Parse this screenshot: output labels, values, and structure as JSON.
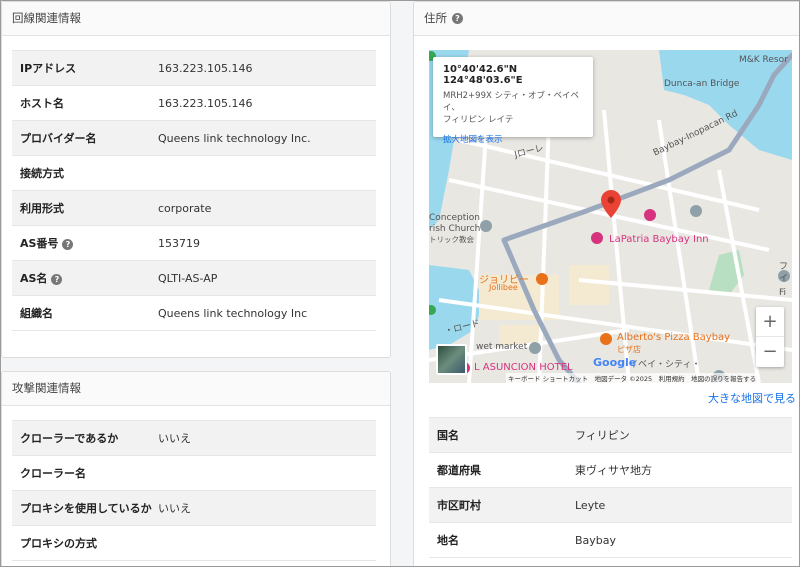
{
  "network": {
    "title": "回線関連情報",
    "rows": [
      {
        "key": "IPアドレス",
        "value": "163.223.105.146",
        "help": false
      },
      {
        "key": "ホスト名",
        "value": "163.223.105.146",
        "help": false
      },
      {
        "key": "プロバイダー名",
        "value": "Queens link technology Inc.",
        "help": false
      },
      {
        "key": "接続方式",
        "value": "",
        "help": false
      },
      {
        "key": "利用形式",
        "value": "corporate",
        "help": false
      },
      {
        "key": "AS番号",
        "value": "153719",
        "help": true
      },
      {
        "key": "AS名",
        "value": "QLTI-AS-AP",
        "help": true
      },
      {
        "key": "組織名",
        "value": "Queens link technology Inc",
        "help": false
      }
    ]
  },
  "attack": {
    "title": "攻撃関連情報",
    "rows": [
      {
        "key": "クローラーであるか",
        "value": "いいえ"
      },
      {
        "key": "クローラー名",
        "value": ""
      },
      {
        "key": "プロキシを使用しているか",
        "value": "いいえ"
      },
      {
        "key": "プロキシの方式",
        "value": ""
      }
    ]
  },
  "address": {
    "title": "住所",
    "map": {
      "coords": "10°40'42.6\"N 124°48'03.6\"E",
      "plus_code": "MRH2+99X シティ・オブ・ベイベイ、",
      "region": "フィリピン レイテ",
      "enlarge_link": "拡大地図を表示",
      "labels": {
        "mk": "M&K Resor",
        "dunca": "Dunca-an Bridge",
        "baybay_road": "Baybay-Inopacan Rd",
        "conception1": "Conception",
        "conception2": "rish Church",
        "conception3": "トリック教会",
        "lapatria": "LaPatria Baybay Inn",
        "jollibee1": "ジョリビー",
        "jollibee2": "Jollibee",
        "alberto1": "Alberto's Pizza Baybay",
        "alberto2": "ピザ店",
        "wet_market": "wet market",
        "asuncion": "L ASUNCION HOTEL",
        "city": "イベイ・シティ・",
        "road1": "Jローレ",
        "road2": "・ロード",
        "side1": "フ",
        "side2": "イ",
        "side3": "Fi"
      },
      "attribution": "キーボード ショートカット　地図データ ©2025　利用規約　地図の誤りを報告する",
      "google": "Google",
      "zoom_in": "+",
      "zoom_out": "−"
    },
    "view_larger": "大きな地図で見る",
    "rows": [
      {
        "key": "国名",
        "value": "フィリピン"
      },
      {
        "key": "都道府県",
        "value": "東ヴィサヤ地方"
      },
      {
        "key": "市区町村",
        "value": "Leyte"
      },
      {
        "key": "地名",
        "value": "Baybay"
      }
    ]
  },
  "colors": {
    "link": "#1a73e8",
    "pin": "#ea4335",
    "poi": "#d6337f",
    "water": "#9ad8ee",
    "road": "#9aa9bd"
  }
}
